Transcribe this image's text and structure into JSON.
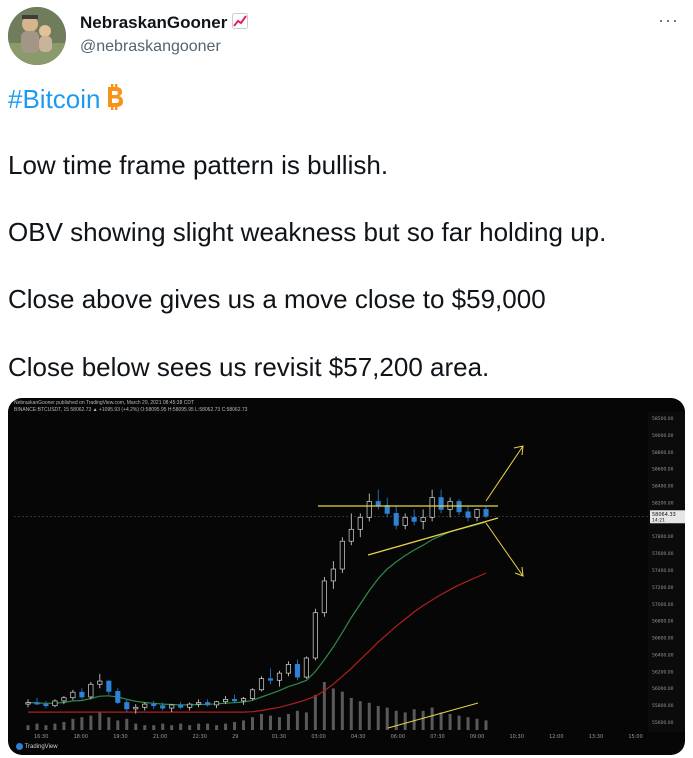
{
  "author": {
    "display_name": "NebraskanGooner",
    "handle": "@nebraskangooner",
    "name_emoji": "chart-increasing-icon"
  },
  "tweet": {
    "hashtag": "#Bitcoin",
    "hashtag_emoji": "bitcoin-icon",
    "lines": [
      "Low time frame pattern is bullish.",
      "OBV showing slight weakness but so far holding up.",
      "Close above gives us a move close to $59,000",
      "Close below sees us revisit $57,200 area."
    ]
  },
  "menu": {
    "more_label": "···"
  },
  "colors": {
    "link": "#1d9bf0",
    "up": "#d9d9d9",
    "down": "#2d83d6",
    "trend": "#e8d24a",
    "ma_fast": "#2f8a4a",
    "ma_slow": "#b01f1f"
  },
  "chart_data": {
    "type": "line",
    "title": "",
    "header_line1": "NebraskanGooner published on TradingView.com, March 29, 2021 08:45:38 CDT",
    "header_line2": "BINANCE:BTCUSDT, 15  58062.73 ▲ +1095.93 (+4.2%)  O:58095.95  H:58095.95  L:58062.73  C:58062.73",
    "watermark": "TradingView",
    "y_ticks": [
      "58500.00",
      "59000.00",
      "58800.00",
      "58600.00",
      "58400.00",
      "58200.00",
      "58000.00",
      "57800.00",
      "57600.00",
      "57400.00",
      "57200.00",
      "57000.00",
      "56800.00",
      "56600.00",
      "56400.00",
      "56200.00",
      "56000.00",
      "55800.00",
      "55600.00"
    ],
    "x_ticks": [
      "16:30",
      "18:00",
      "19:30",
      "21:00",
      "22:30",
      "29",
      "01:30",
      "03:00",
      "04:30",
      "06:00",
      "07:30",
      "09:00",
      "10:30",
      "12:00",
      "13:30",
      "15:00"
    ],
    "price_label": "58064.33",
    "price_sublabel": "14:21",
    "ylim": [
      55500,
      59200
    ],
    "candles": [
      [
        55700,
        55760,
        55660,
        55720
      ],
      [
        55720,
        55780,
        55690,
        55700
      ],
      [
        55700,
        55740,
        55650,
        55680
      ],
      [
        55680,
        55760,
        55660,
        55740
      ],
      [
        55740,
        55800,
        55700,
        55780
      ],
      [
        55780,
        55880,
        55750,
        55850
      ],
      [
        55850,
        55900,
        55760,
        55790
      ],
      [
        55790,
        55980,
        55760,
        55950
      ],
      [
        55950,
        56080,
        55900,
        55990
      ],
      [
        55990,
        56000,
        55820,
        55860
      ],
      [
        55860,
        55900,
        55700,
        55720
      ],
      [
        55720,
        55760,
        55600,
        55640
      ],
      [
        55640,
        55700,
        55580,
        55660
      ],
      [
        55660,
        55720,
        55620,
        55700
      ],
      [
        55700,
        55740,
        55640,
        55680
      ],
      [
        55680,
        55720,
        55620,
        55650
      ],
      [
        55650,
        55700,
        55600,
        55690
      ],
      [
        55690,
        55730,
        55640,
        55660
      ],
      [
        55660,
        55720,
        55620,
        55700
      ],
      [
        55700,
        55760,
        55660,
        55720
      ],
      [
        55720,
        55760,
        55670,
        55690
      ],
      [
        55690,
        55740,
        55650,
        55730
      ],
      [
        55730,
        55800,
        55700,
        55760
      ],
      [
        55760,
        55820,
        55720,
        55740
      ],
      [
        55740,
        55790,
        55690,
        55770
      ],
      [
        55770,
        55900,
        55750,
        55880
      ],
      [
        55880,
        56050,
        55860,
        56020
      ],
      [
        56020,
        56150,
        55950,
        56000
      ],
      [
        56000,
        56120,
        55920,
        56090
      ],
      [
        56090,
        56240,
        56050,
        56200
      ],
      [
        56200,
        56260,
        56000,
        56040
      ],
      [
        56040,
        56300,
        56020,
        56280
      ],
      [
        56280,
        56900,
        56250,
        56850
      ],
      [
        56850,
        57300,
        56800,
        57250
      ],
      [
        57250,
        57500,
        57150,
        57400
      ],
      [
        57400,
        57800,
        57350,
        57750
      ],
      [
        57750,
        58100,
        57700,
        57900
      ],
      [
        57900,
        58100,
        57800,
        58050
      ],
      [
        58050,
        58350,
        58000,
        58250
      ],
      [
        58250,
        58400,
        58150,
        58200
      ],
      [
        58200,
        58300,
        58050,
        58100
      ],
      [
        58100,
        58200,
        57900,
        57950
      ],
      [
        57950,
        58100,
        57900,
        58050
      ],
      [
        58050,
        58150,
        57950,
        58000
      ],
      [
        58000,
        58150,
        57900,
        58050
      ],
      [
        58050,
        58400,
        58000,
        58300
      ],
      [
        58300,
        58400,
        58100,
        58150
      ],
      [
        58150,
        58300,
        58050,
        58250
      ],
      [
        58250,
        58280,
        58080,
        58120
      ],
      [
        58120,
        58200,
        58000,
        58050
      ],
      [
        58050,
        58160,
        58000,
        58150
      ],
      [
        58150,
        58200,
        58040,
        58064
      ]
    ],
    "ma_fast": [
      55720,
      55715,
      55710,
      55712,
      55720,
      55740,
      55745,
      55770,
      55800,
      55805,
      55790,
      55760,
      55735,
      55720,
      55710,
      55700,
      55695,
      55690,
      55690,
      55695,
      55698,
      55703,
      55712,
      55718,
      55726,
      55748,
      55790,
      55830,
      55870,
      55920,
      55955,
      56000,
      56110,
      56260,
      56420,
      56600,
      56790,
      56960,
      57130,
      57280,
      57400,
      57490,
      57570,
      57640,
      57700,
      57770,
      57820,
      57870,
      57900,
      57930,
      57960,
      57990
    ],
    "ma_slow": [
      55600,
      55600,
      55600,
      55600,
      55600,
      55600,
      55600,
      55600,
      55600,
      55600,
      55600,
      55600,
      55600,
      55600,
      55600,
      55600,
      55600,
      55600,
      55600,
      55600,
      55600,
      55600,
      55600,
      55600,
      55600,
      55605,
      55620,
      55640,
      55660,
      55690,
      55720,
      55755,
      55800,
      55870,
      55950,
      56050,
      56150,
      56260,
      56370,
      56480,
      56580,
      56680,
      56770,
      56860,
      56940,
      57010,
      57080,
      57140,
      57200,
      57250,
      57300,
      57350
    ],
    "volumes": [
      3,
      4,
      3,
      4,
      5,
      7,
      8,
      9,
      11,
      8,
      6,
      7,
      4,
      3,
      3,
      4,
      3,
      4,
      3,
      4,
      4,
      3,
      4,
      5,
      6,
      8,
      10,
      9,
      8,
      10,
      12,
      11,
      22,
      30,
      26,
      24,
      20,
      18,
      17,
      15,
      14,
      12,
      11,
      13,
      12,
      14,
      11,
      10,
      9,
      8,
      7,
      6
    ]
  }
}
